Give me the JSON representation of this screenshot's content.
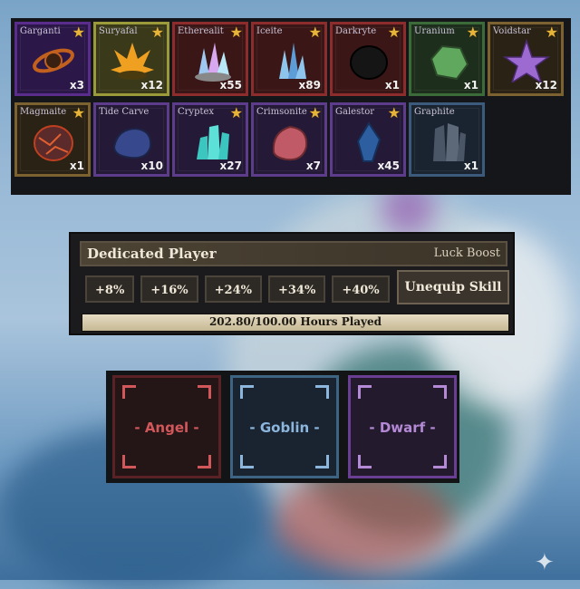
{
  "inventory": {
    "items": [
      {
        "name": "Garganti",
        "count": "x3",
        "starred": true,
        "icon": "ringed-planet-ore-icon",
        "colors": {
          "border": "#5a2c8c",
          "bg": "#2c1848",
          "icon": "#c2601e"
        }
      },
      {
        "name": "Suryafal",
        "count": "x12",
        "starred": true,
        "icon": "flame-crystal-icon",
        "colors": {
          "border": "#9a9a3a",
          "bg": "#3a3a1a",
          "icon": "#f0a020"
        }
      },
      {
        "name": "Etherealit",
        "count": "x55",
        "starred": true,
        "icon": "prismatic-crystal-icon",
        "colors": {
          "border": "#8c2c2c",
          "bg": "#3a1616",
          "icon": "#9fc8f0"
        }
      },
      {
        "name": "Iceite",
        "count": "x89",
        "starred": true,
        "icon": "ice-crystal-icon",
        "colors": {
          "border": "#8c2c2c",
          "bg": "#3a1616",
          "icon": "#8ec5ec"
        }
      },
      {
        "name": "Darkryte",
        "count": "x1",
        "starred": true,
        "icon": "dark-rock-icon",
        "colors": {
          "border": "#8c2c2c",
          "bg": "#3a1616",
          "icon": "#151515"
        }
      },
      {
        "name": "Uranium",
        "count": "x1",
        "starred": true,
        "icon": "green-rock-icon",
        "colors": {
          "border": "#3c6b3a",
          "bg": "#1e2e1c",
          "icon": "#5fa85d"
        }
      },
      {
        "name": "Voidstar",
        "count": "x12",
        "starred": true,
        "icon": "purple-star-icon",
        "colors": {
          "border": "#7c6230",
          "bg": "#2a2215",
          "icon": "#9c6ad0"
        }
      },
      {
        "name": "Magmaite",
        "count": "x1",
        "starred": true,
        "icon": "magma-rock-icon",
        "colors": {
          "border": "#7c6230",
          "bg": "#2a2215",
          "icon": "#5b2a2a"
        }
      },
      {
        "name": "Tide Carve",
        "count": "x10",
        "starred": false,
        "icon": "blue-rock-icon",
        "colors": {
          "border": "#5e3c8c",
          "bg": "#241936",
          "icon": "#38488c"
        }
      },
      {
        "name": "Cryptex",
        "count": "x27",
        "starred": true,
        "icon": "cyan-crystal-icon",
        "colors": {
          "border": "#5e3c8c",
          "bg": "#241936",
          "icon": "#3cc6c0"
        }
      },
      {
        "name": "Crimsonite",
        "count": "x7",
        "starred": true,
        "icon": "crimson-rock-icon",
        "colors": {
          "border": "#5e3c8c",
          "bg": "#241936",
          "icon": "#c05a66"
        }
      },
      {
        "name": "Galestor",
        "count": "x45",
        "starred": true,
        "icon": "blue-shard-icon",
        "colors": {
          "border": "#5e3c8c",
          "bg": "#241936",
          "icon": "#2c5ea0"
        }
      },
      {
        "name": "Graphite",
        "count": "x1",
        "starred": false,
        "icon": "graphite-column-icon",
        "colors": {
          "border": "#3c5a7c",
          "bg": "#1a2430",
          "icon": "#4a5566"
        }
      }
    ]
  },
  "skill": {
    "title": "Dedicated Player",
    "type": "Luck Boost",
    "perks": [
      "+8%",
      "+16%",
      "+24%",
      "+34%",
      "+40%"
    ],
    "unequip_label": "Unequip Skill",
    "progress_text": "202.80/100.00 Hours Played",
    "progress_fraction": 1.0
  },
  "races": [
    {
      "label": "- Angel -",
      "color": "#d2575a",
      "border": "#5a2224",
      "bg": "#241617"
    },
    {
      "label": "- Goblin -",
      "color": "#8cb6dc",
      "border": "#3e6484",
      "bg": "#1a2330"
    },
    {
      "label": "- Dwarf -",
      "color": "#b48ad6",
      "border": "#6a3e92",
      "bg": "#231a2e"
    }
  ]
}
